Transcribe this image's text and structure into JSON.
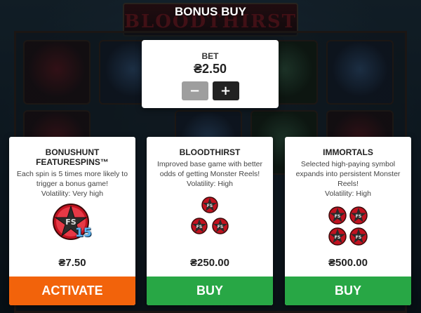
{
  "background": {
    "logo_text": "BLOODTHIRST"
  },
  "title": "BONUS BUY",
  "bet": {
    "label": "BET",
    "value": "₴2.50",
    "minus_label": "−",
    "plus_label": "+"
  },
  "cards": [
    {
      "title_line1": "BONUSHUNT",
      "title_line2": "FEATURESPINS™",
      "description": "Each spin is 5 times more likely to trigger a bonus game!",
      "volatility": "Volatility: Very high",
      "icon": "fs-pentagram-icon",
      "icon_badge": "15",
      "price": "₴7.50",
      "button_label": "ACTIVATE",
      "button_color": "#f2630b"
    },
    {
      "title_line1": "BLOODTHIRST",
      "description": "Improved base game with better odds of getting Monster Reels!",
      "volatility": "Volatility: High",
      "icon": "fs-pentagram-cluster-3-icon",
      "icon_text": "FS",
      "price": "₴250.00",
      "button_label": "BUY",
      "button_color": "#28a745"
    },
    {
      "title_line1": "IMMORTALS",
      "description": "Selected high-paying symbol expands into persistent Monster Reels!",
      "volatility": "Volatility: High",
      "icon": "fs-pentagram-cluster-4-icon",
      "icon_text": "FS",
      "price": "₴500.00",
      "button_label": "BUY",
      "button_color": "#28a745"
    }
  ]
}
